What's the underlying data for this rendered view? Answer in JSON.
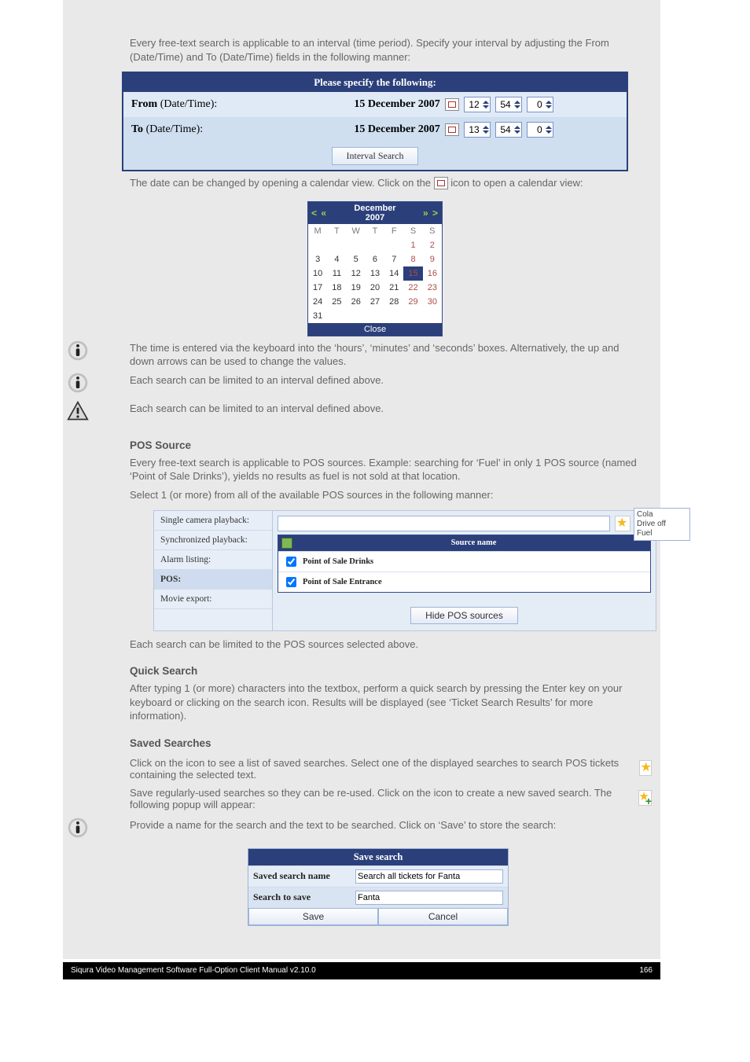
{
  "intro_text": "Every free-text search is applicable to an interval (time period). Specify your interval by adjusting the From (Date/Time) and To (Date/Time) fields in the following manner:",
  "interval_panel": {
    "title": "Please specify the following:",
    "from_label_bold": "From",
    "to_label_bold": "To",
    "date_time_suffix": " (Date/Time):",
    "from_date": "15 December 2007",
    "to_date": "15 December 2007",
    "from_hh": "12",
    "from_mm": "54",
    "from_ss": "0",
    "to_hh": "13",
    "to_mm": "54",
    "to_ss": "0",
    "button": "Interval Search"
  },
  "calendar_text_lead": "The date can be changed by opening a calendar view. Click on the ",
  "calendar_text_tail": " icon to open a calendar view:",
  "calendar": {
    "month_line1": "December",
    "month_line2": "2007",
    "dow": [
      "M",
      "T",
      "W",
      "T",
      "F",
      "S",
      "S"
    ],
    "weeks": [
      [
        "",
        "",
        "",
        "",
        "",
        "1",
        "2"
      ],
      [
        "3",
        "4",
        "5",
        "6",
        "7",
        "8",
        "9"
      ],
      [
        "10",
        "11",
        "12",
        "13",
        "14",
        "15",
        "16"
      ],
      [
        "17",
        "18",
        "19",
        "20",
        "21",
        "22",
        "23"
      ],
      [
        "24",
        "25",
        "26",
        "27",
        "28",
        "29",
        "30"
      ],
      [
        "31",
        "",
        "",
        "",
        "",
        "",
        ""
      ]
    ],
    "today_value": "15",
    "close": "Close"
  },
  "note_time_entry": "The time is entered via the keyboard into the ‘hours’, ‘minutes’ and ‘seconds’ boxes. Alternatively, the up and down arrows can be used to change the values.",
  "note_each_search": "Each search can be limited to an interval defined above.",
  "heading_pos_source": "POS Source",
  "pos_text1": "Every free-text search is applicable to POS sources. Example: searching for ‘Fuel’ in only 1 POS source (named ‘Point of Sale Drinks’), yields no results as fuel is not sold at that location.",
  "pos_text2": "Select 1 (or more) from all of the available POS sources in the following manner:",
  "pos_sidebar": {
    "items": [
      "Single camera playback:",
      "Synchronized playback:",
      "Alarm listing:",
      "POS:",
      "Movie export:"
    ],
    "active_index": 3
  },
  "pos_main": {
    "source_header": "Source name",
    "sources": [
      "Point of Sale Drinks",
      "Point of Sale Entrance"
    ],
    "hide_button": "Hide POS sources",
    "dropdown_items": [
      "Cola",
      "Drive off",
      "Fuel"
    ]
  },
  "pos_text3": "Each search can be limited to the POS sources selected above.",
  "heading_quick_search": "Quick Search",
  "quick_text1": "After typing 1 (or more) characters into the textbox, perform a quick search by pressing the Enter key on your keyboard or clicking on the search icon. Results will be displayed (see ‘Ticket Search Results’ for more information).",
  "heading_saved_searches": "Saved Searches",
  "saved_line1_lead": "Click on the ",
  "saved_line1_tail": " icon to see a list of saved searches. Select one of the displayed searches to search POS tickets containing the selected text.",
  "saved_line2_lead": "Save regularly-used searches so they can be re-used. Click on the ",
  "saved_line2_tail": " icon to create a new saved search. The following popup will appear:",
  "note_save_hint": "Provide a name for the search and the text to be searched. Click on ‘Save’ to store the search:",
  "save_dialog": {
    "title": "Save search",
    "row1_label": "Saved search name",
    "row1_value": "Search all tickets for Fanta",
    "row2_label": "Search to save",
    "row2_value": "Fanta",
    "save": "Save",
    "cancel": "Cancel"
  },
  "footer": {
    "left": "Siqura Video Management Software Full-Option Client Manual v2.10.0",
    "right": "166"
  }
}
